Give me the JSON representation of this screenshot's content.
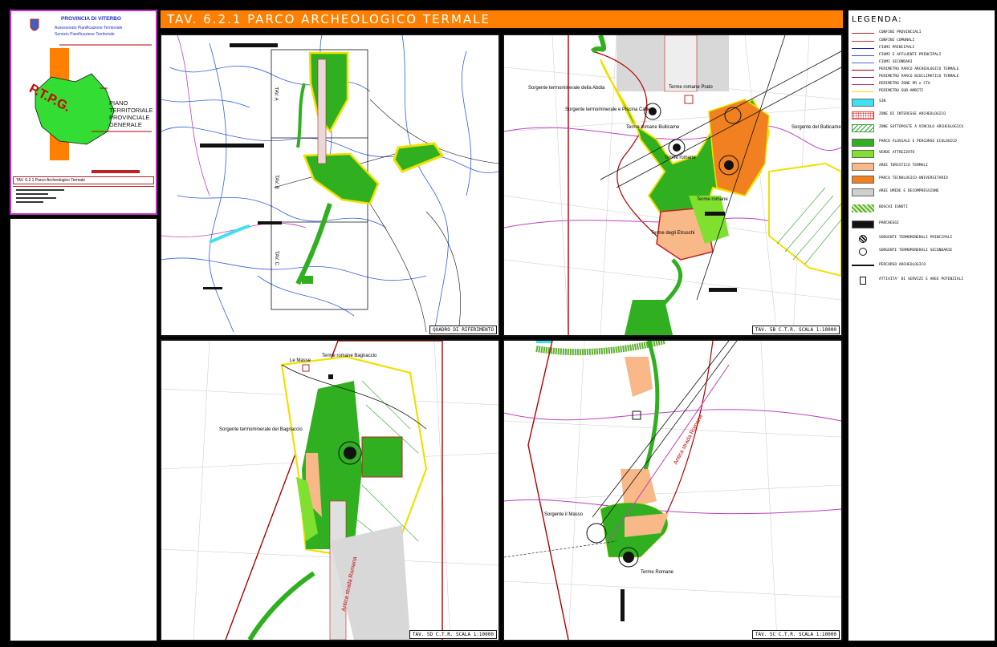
{
  "title": "TAV. 6.2.1  PARCO ARCHEOLOGICO TERMALE",
  "logo": {
    "org": "PROVINCIA DI VITERBO",
    "dept1": "Assessorato Pianificazione Territoriale",
    "dept2": "Servizio Pianificazione Territoriale",
    "ptpg": "P.T.P.G.",
    "plan_lines": [
      "PIANO",
      "TERRITORIALE",
      "PROVINCIALE",
      "GENERALE"
    ],
    "sheet": "TAV. 6.2.1 Parco Archeologico Termale"
  },
  "legend": {
    "title": "LEGENDA:",
    "items": [
      {
        "label": "CONFINI PROVINCIALI",
        "kind": "line",
        "color": "#d02020"
      },
      {
        "label": "CONFINI COMUNALI",
        "kind": "line",
        "color": "#e03030"
      },
      {
        "label": "FIUMI PRINCIPALI",
        "kind": "line",
        "color": "#2020c0"
      },
      {
        "label": "FIUMI E AFFLUENTI PRINCIPALI",
        "kind": "line",
        "color": "#3050d0"
      },
      {
        "label": "FIUMI SECONDARI",
        "kind": "line",
        "color": "#4070e0"
      },
      {
        "label": "PERIMETRO PARCO ARCHEOLOGICO TERMALE",
        "kind": "line",
        "color": "#a00000"
      },
      {
        "label": "PERIMETRO PARCO BIOCLIMATICO TERMALE",
        "kind": "line",
        "color": "#6a0a6a"
      },
      {
        "label": "PERIMETRO ZONE PR e CTA",
        "kind": "line",
        "color": "#c03060"
      },
      {
        "label": "PERIMETRO SUB-AMBITI",
        "kind": "line",
        "color": "#f0e000"
      },
      {
        "label": "SIN",
        "kind": "fill",
        "color": "#40e0f0"
      },
      {
        "label": "ZONE DI INTERESSE ARCHEOLOGICO",
        "kind": "dots",
        "color": "#e04040"
      },
      {
        "label": "ZONE SOTTOPOSTE A VINCOLO ARCHEOLOGICO",
        "kind": "hatch",
        "color": "#30a030"
      },
      {
        "label": "PARCO FLUVIALE E PERCORSO ECOLOGICO",
        "kind": "fill",
        "color": "#30b020"
      },
      {
        "label": "VERDE ATTREZZATO",
        "kind": "fill",
        "color": "#80e030"
      },
      {
        "label": "AREE TURISTICO TERMALI",
        "kind": "fill",
        "color": "#f8b888"
      },
      {
        "label": "PARCO TECNOLOGICO-UNIVERSITARIO",
        "kind": "fill",
        "color": "#f08020"
      },
      {
        "label": "AREE UMIDE E DECOMPRESSIONE",
        "kind": "fill",
        "color": "#d0d0d0"
      },
      {
        "label": "BOSCHI IGNOTI",
        "kind": "hatch2",
        "color": "#60b030"
      },
      {
        "label": "PARCHEGGI",
        "kind": "fill",
        "color": "#111111"
      },
      {
        "label": "SORGENTI TERMOMINERALI PRINCIPALI",
        "kind": "circle",
        "color": "#111111"
      },
      {
        "label": "SORGENTI TERMOMINERALI SECONDARIE",
        "kind": "circle2",
        "color": "#111111"
      },
      {
        "label": "PERCORSO ARCHEOLOGICO",
        "kind": "path",
        "color": "#111111"
      },
      {
        "label": "ATTIVITA' DI SERVIZI E AREE POTENZIALI",
        "kind": "box",
        "color": "#111111"
      }
    ]
  },
  "panels": {
    "p1": {
      "label": "QUADRO DI RIFERIMENTO",
      "frames": [
        "TAV. A",
        "TAV. B",
        "TAV. C"
      ]
    },
    "p2": {
      "label": "TAV. 5B C.T.R. SCALA 1:10000",
      "places": [
        "Sorgente termominerale della Abdia",
        "Sorgente termominerale e Piscina Carletti",
        "Terme romane Prato",
        "Terme romane Bullicame",
        "Sorgente del Bullicame",
        "Terme romane",
        "Terme romane",
        "Terme degli Etruschi"
      ]
    },
    "p3": {
      "label": "TAV. 5D C.T.R. SCALA 1:10000",
      "places": [
        "Terme romane Bagnaccio",
        "Le Masse",
        "Sorgente termominerale del Bagnaccio",
        "Antica strada Romana"
      ]
    },
    "p4": {
      "label": "TAV. 5C C.T.R. SCALA 1:10000",
      "places": [
        "Sorgente il Masso",
        "Terme Romane",
        "Antica strada Romana"
      ]
    }
  },
  "colors": {
    "orange": "#ff8000",
    "green": "#30b020",
    "light_green": "#80e030",
    "peach": "#f8b888",
    "yellow": "#f0e000",
    "red": "#b00000",
    "magenta": "#c030c0"
  }
}
